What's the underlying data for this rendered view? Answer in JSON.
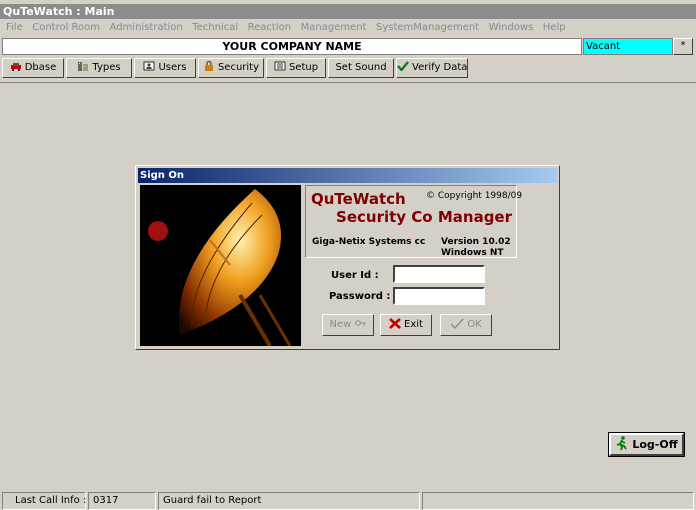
{
  "window": {
    "title": "QuTeWatch : Main"
  },
  "menu": [
    "File",
    "Control Room",
    "Administration",
    "Technical",
    "Reaction",
    "Management",
    "SystemManagement",
    "Windows",
    "Help"
  ],
  "header": {
    "company": "YOUR COMPANY NAME",
    "status": "Vacant",
    "status_button": "*"
  },
  "toolbar": {
    "dbase": "Dbase",
    "types": "Types",
    "users": "Users",
    "security": "Security",
    "setup": "Setup",
    "set_sound": "Set Sound",
    "verify": "Verify Data"
  },
  "dialog": {
    "title": "Sign On",
    "app_name_1": "QuTeWatch",
    "app_name_2": "Security Co Manager",
    "copyright": "© Copyright 1998/09",
    "company": "Giga-Netix Systems cc",
    "version_1": "Version 10.02",
    "version_2": "Windows NT",
    "user_label": "User Id :",
    "password_label": "Password :",
    "user_value": "",
    "password_value": "",
    "new_label": "New",
    "exit_label": "Exit",
    "ok_label": "OK"
  },
  "logoff_label": "Log-Off",
  "status": {
    "label": "Last Call Info :",
    "code": "0317",
    "message": "Guard fail to Report"
  },
  "colors": {
    "accent": "#00ffff",
    "dialog_title": "#0a246a",
    "app_name": "#800000"
  }
}
